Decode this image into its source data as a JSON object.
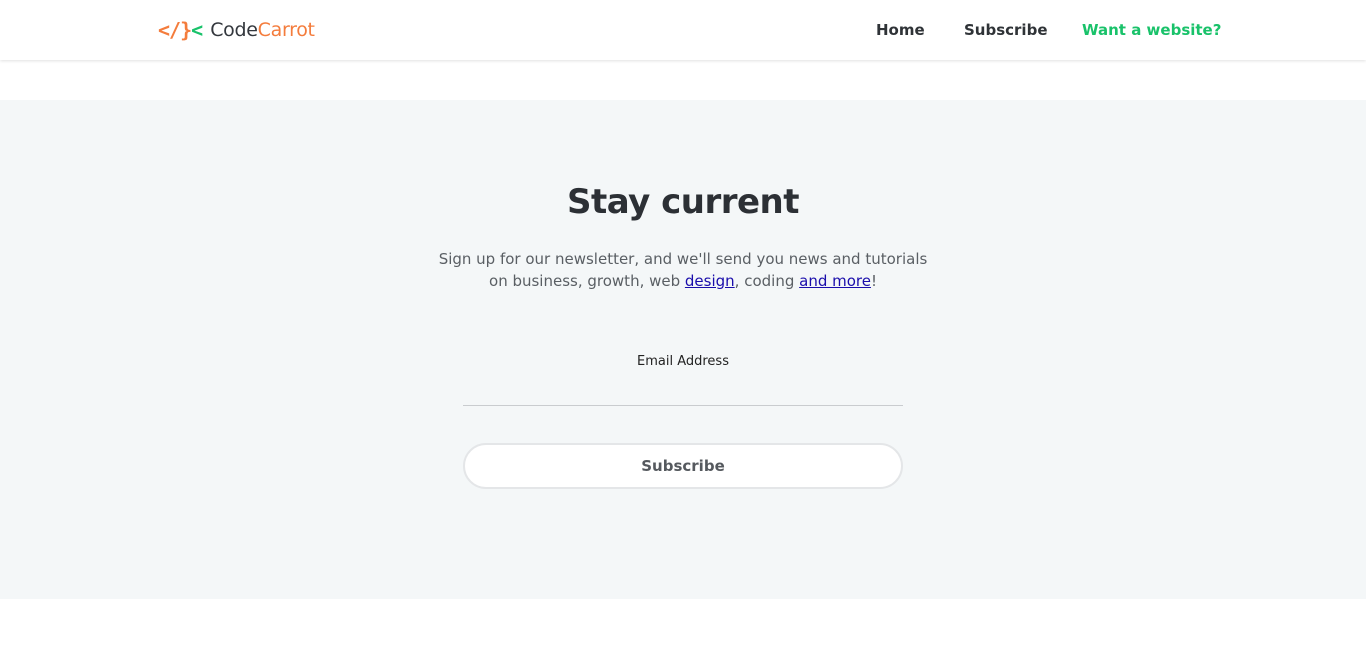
{
  "header": {
    "logo": {
      "mark_left": "</",
      "mark_brace": "}",
      "mark_right": "<",
      "text_code": "Code",
      "text_carrot": "Carrot"
    },
    "nav": {
      "home": "Home",
      "subscribe": "Subscribe",
      "website": "Want a website?"
    }
  },
  "hero": {
    "title": "Stay current",
    "lead_part1": "Sign up for our newsletter, and we'll send you news and tutorials on business, growth, web ",
    "lead_link1": "design",
    "lead_part2": ", coding ",
    "lead_link2": "and more",
    "lead_part3": "!",
    "email_label": "Email Address",
    "email_value": "",
    "email_placeholder": "",
    "subscribe_label": "Subscribe"
  },
  "colors": {
    "brand_orange": "#f47c3c",
    "brand_green": "#19c26a",
    "hero_background": "#f4f7f8",
    "link_blue": "#1a0dab"
  }
}
